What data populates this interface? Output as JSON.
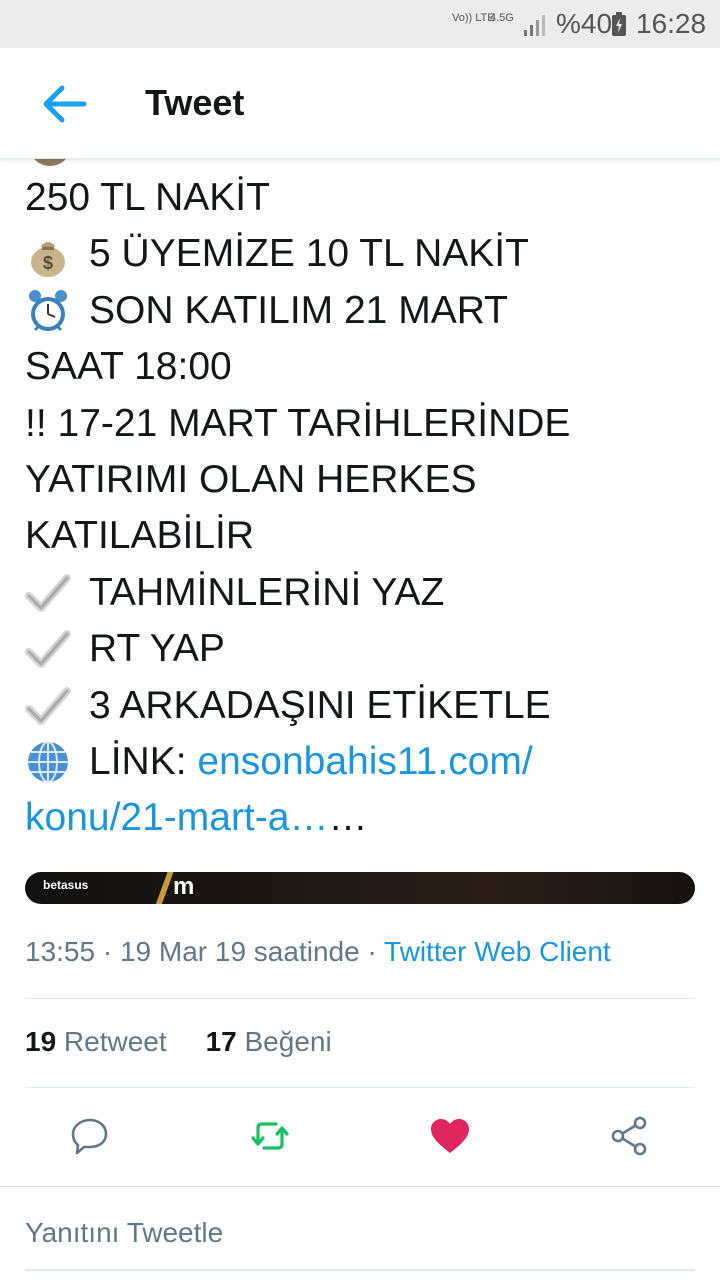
{
  "status_bar": {
    "volte": "Vo)) LTE",
    "network": "4.5G",
    "battery": "%40",
    "time": "16:28"
  },
  "app_bar": {
    "title": "Tweet"
  },
  "tweet": {
    "lines": [
      {
        "emoji": "",
        "text": "250 TL NAKİT"
      },
      {
        "emoji": "money-bag-icon",
        "text": "5 ÜYEMİZE 10 TL NAKİT"
      },
      {
        "emoji": "alarm-clock-icon",
        "text": "SON KATILIM 21 MART"
      },
      {
        "emoji": "",
        "text": "SAAT 18:00"
      },
      {
        "emoji": "",
        "text": "!! 17-21 MART TARİHLERİNDE"
      },
      {
        "emoji": "",
        "text": "YATIRIMI OLAN HERKES"
      },
      {
        "emoji": "",
        "text": "KATILABİLİR"
      },
      {
        "emoji": "check-mark-icon",
        "text": "TAHMİNLERİNİ YAZ"
      },
      {
        "emoji": "check-mark-icon",
        "text": "RT YAP"
      },
      {
        "emoji": "check-mark-icon",
        "text": "3 ARKADAŞINI ETİKETLE"
      }
    ],
    "link_prefix": "LİNK: ",
    "link_part1": "ensonbahis11.com/",
    "link_part2": "konu/21-mart-a…",
    "ellipsis": " …",
    "media": {
      "logo": "betasus",
      "text": "m"
    },
    "timestamp": "13:55 · 19 Mar 19 saatinde · ",
    "client": "Twitter Web Client",
    "retweet_count": "19",
    "retweet_label": " Retweet",
    "like_count": "17",
    "like_label": " Beğeni"
  },
  "reply": {
    "placeholder": "Yanıtını Tweetle"
  },
  "colors": {
    "link": "#1b95e0",
    "retweet": "#17bf63",
    "like": "#e0245e",
    "muted": "#657786"
  }
}
